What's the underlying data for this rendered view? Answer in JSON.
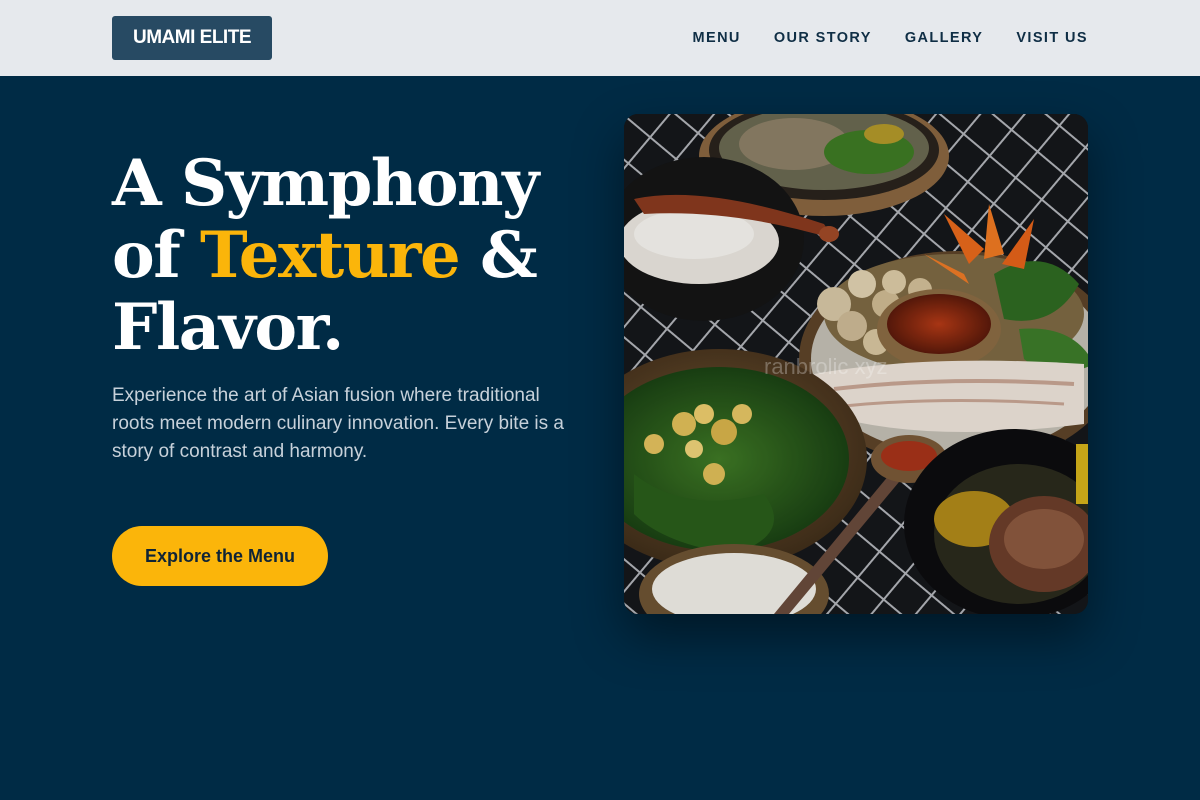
{
  "nav": {
    "brand": "UMAMI ELITE",
    "links": [
      {
        "label": "MENU"
      },
      {
        "label": "OUR STORY"
      },
      {
        "label": "GALLERY"
      },
      {
        "label": "VISIT US"
      }
    ]
  },
  "hero": {
    "headline_line1": "A Symphony",
    "headline_of": "of ",
    "headline_accent": "Texture",
    "headline_amp": " &",
    "headline_line3": "Flavor.",
    "description": "Experience the art of Asian fusion where traditional roots meet modern culinary innovation. Every bite is a story of contrast and harmony.",
    "cta_label": "Explore the Menu",
    "image_watermark": "ranbrolic xyz"
  },
  "colors": {
    "nav_background": "#e6e9ed",
    "brand_background": "#274a63",
    "hero_background": "#002b45",
    "accent": "#fbb50a"
  }
}
